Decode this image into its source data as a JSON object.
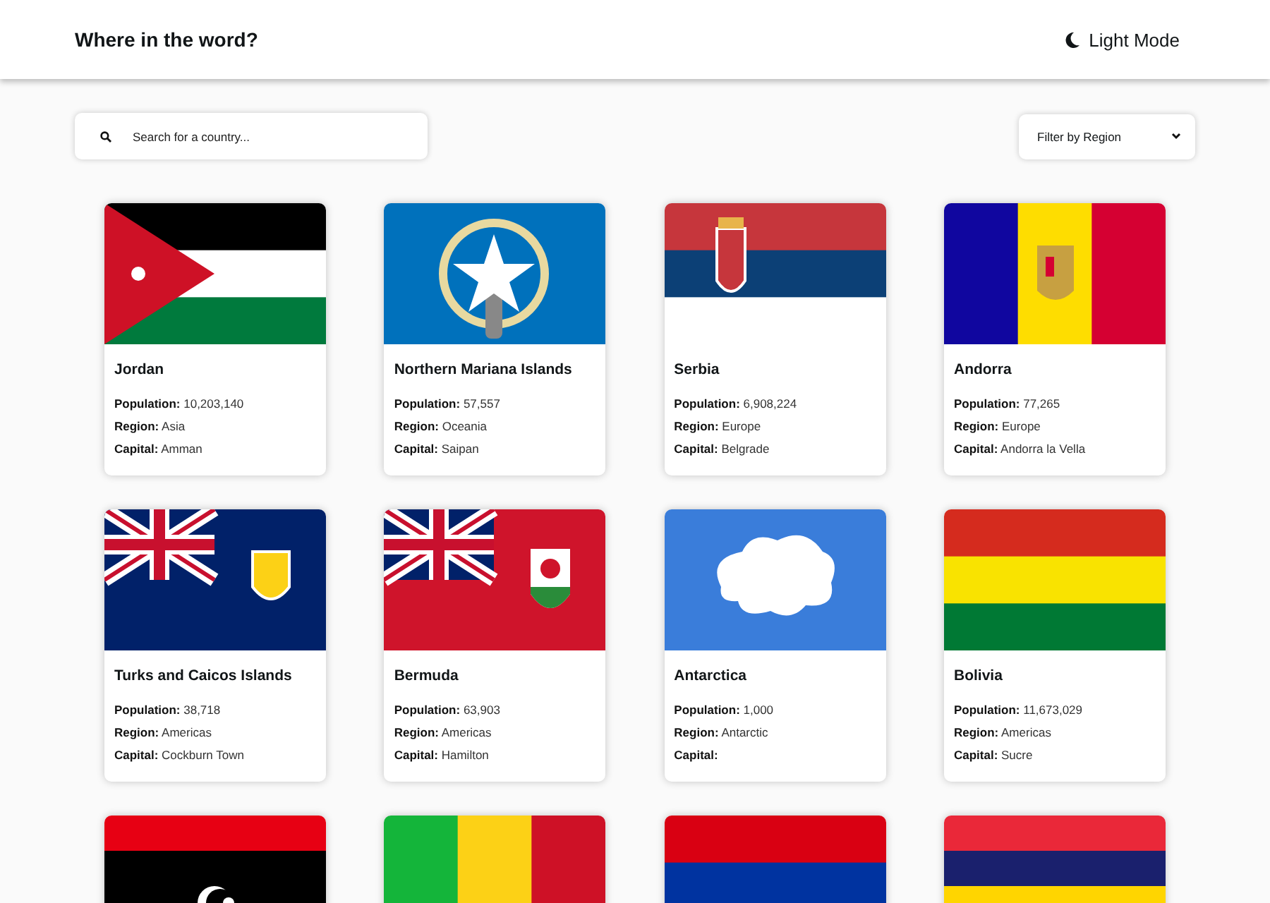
{
  "header": {
    "title": "Where in the word?",
    "theme_toggle": "Light Mode"
  },
  "search": {
    "placeholder": "Search for a country..."
  },
  "filter": {
    "label": "Filter by Region"
  },
  "cards": [
    {
      "kind": "full",
      "name": "Jordan",
      "population_label": "Population:",
      "population": "10,203,140",
      "region_label": "Region:",
      "region": "Asia",
      "capital_label": "Capital:",
      "capital": "Amman"
    },
    {
      "kind": "full",
      "name": "Northern Mariana Islands",
      "population_label": "Population:",
      "population": "57,557",
      "region_label": "Region:",
      "region": "Oceania",
      "capital_label": "Capital:",
      "capital": "Saipan"
    },
    {
      "kind": "full",
      "name": "Serbia",
      "population_label": "Population:",
      "population": "6,908,224",
      "region_label": "Region:",
      "region": "Europe",
      "capital_label": "Capital:",
      "capital": "Belgrade"
    },
    {
      "kind": "full",
      "name": "Andorra",
      "population_label": "Population:",
      "population": "77,265",
      "region_label": "Region:",
      "region": "Europe",
      "capital_label": "Capital:",
      "capital": "Andorra la Vella"
    },
    {
      "kind": "full",
      "name": "Turks and Caicos Islands",
      "population_label": "Population:",
      "population": "38,718",
      "region_label": "Region:",
      "region": "Americas",
      "capital_label": "Capital:",
      "capital": "Cockburn Town"
    },
    {
      "kind": "full",
      "name": "Bermuda",
      "population_label": "Population:",
      "population": "63,903",
      "region_label": "Region:",
      "region": "Americas",
      "capital_label": "Capital:",
      "capital": "Hamilton"
    },
    {
      "kind": "full",
      "name": "Antarctica",
      "population_label": "Population:",
      "population": "1,000",
      "region_label": "Region:",
      "region": "Antarctic",
      "capital_label": "Capital:"
    },
    {
      "kind": "full",
      "name": "Bolivia",
      "population_label": "Population:",
      "population": "11,673,029",
      "region_label": "Region:",
      "region": "Americas",
      "capital_label": "Capital:",
      "capital": "Sucre"
    },
    {
      "kind": "flag_only"
    },
    {
      "kind": "flag_only"
    },
    {
      "kind": "flag_only"
    },
    {
      "kind": "flag_only"
    }
  ]
}
